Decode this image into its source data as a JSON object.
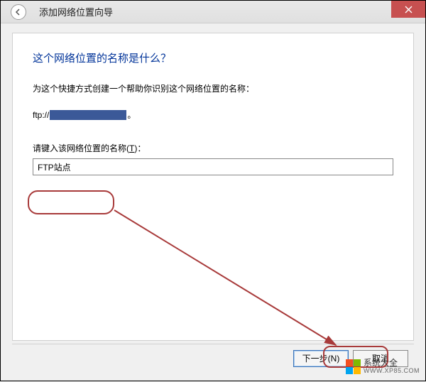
{
  "titlebar": {
    "title": "添加网络位置向导"
  },
  "content": {
    "heading": "这个网络位置的名称是什么？",
    "instruction": "为这个快捷方式创建一个帮助你识别这个网络位置的名称：",
    "ftp_prefix": "ftp://",
    "ftp_suffix": "。",
    "input_label_prefix": "请键入该网络位置的名称(",
    "input_label_key": "T",
    "input_label_suffix": ")：",
    "input_value": "FTP站点"
  },
  "buttons": {
    "next": "下一步(N)",
    "cancel": "取消"
  },
  "watermark": {
    "line1": "系统大全",
    "line2": "WWW.XP85.COM"
  }
}
